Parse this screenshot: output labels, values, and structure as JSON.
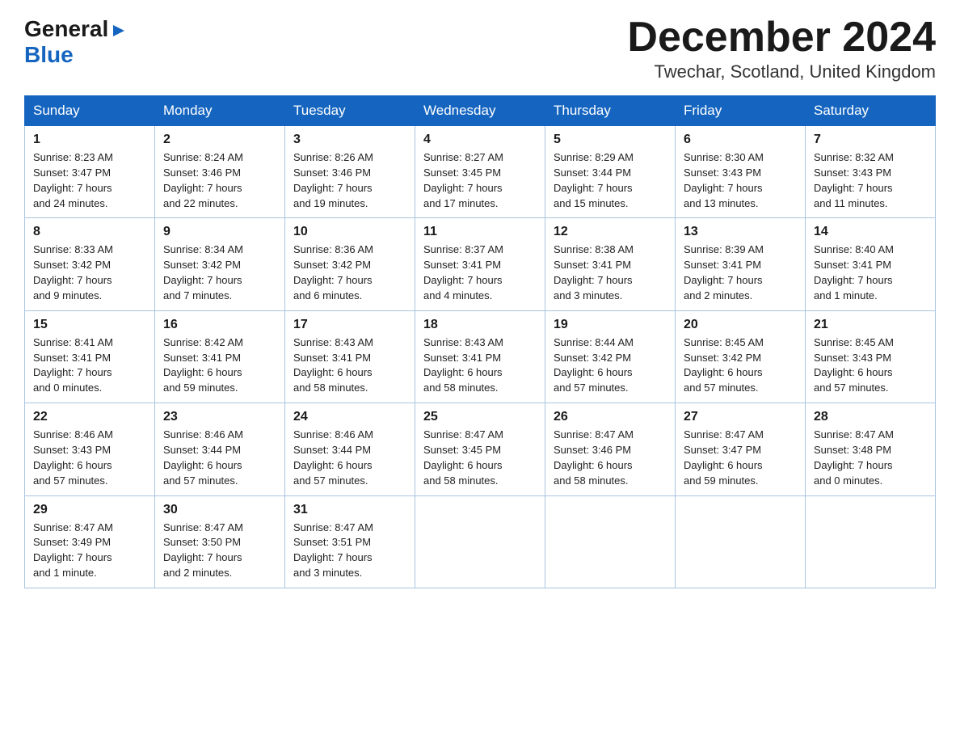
{
  "header": {
    "logo_general": "General",
    "logo_blue": "Blue",
    "month_title": "December 2024",
    "location": "Twechar, Scotland, United Kingdom"
  },
  "weekdays": [
    "Sunday",
    "Monday",
    "Tuesday",
    "Wednesday",
    "Thursday",
    "Friday",
    "Saturday"
  ],
  "weeks": [
    [
      {
        "day": "1",
        "sunrise": "Sunrise: 8:23 AM",
        "sunset": "Sunset: 3:47 PM",
        "daylight": "Daylight: 7 hours",
        "daylight2": "and 24 minutes."
      },
      {
        "day": "2",
        "sunrise": "Sunrise: 8:24 AM",
        "sunset": "Sunset: 3:46 PM",
        "daylight": "Daylight: 7 hours",
        "daylight2": "and 22 minutes."
      },
      {
        "day": "3",
        "sunrise": "Sunrise: 8:26 AM",
        "sunset": "Sunset: 3:46 PM",
        "daylight": "Daylight: 7 hours",
        "daylight2": "and 19 minutes."
      },
      {
        "day": "4",
        "sunrise": "Sunrise: 8:27 AM",
        "sunset": "Sunset: 3:45 PM",
        "daylight": "Daylight: 7 hours",
        "daylight2": "and 17 minutes."
      },
      {
        "day": "5",
        "sunrise": "Sunrise: 8:29 AM",
        "sunset": "Sunset: 3:44 PM",
        "daylight": "Daylight: 7 hours",
        "daylight2": "and 15 minutes."
      },
      {
        "day": "6",
        "sunrise": "Sunrise: 8:30 AM",
        "sunset": "Sunset: 3:43 PM",
        "daylight": "Daylight: 7 hours",
        "daylight2": "and 13 minutes."
      },
      {
        "day": "7",
        "sunrise": "Sunrise: 8:32 AM",
        "sunset": "Sunset: 3:43 PM",
        "daylight": "Daylight: 7 hours",
        "daylight2": "and 11 minutes."
      }
    ],
    [
      {
        "day": "8",
        "sunrise": "Sunrise: 8:33 AM",
        "sunset": "Sunset: 3:42 PM",
        "daylight": "Daylight: 7 hours",
        "daylight2": "and 9 minutes."
      },
      {
        "day": "9",
        "sunrise": "Sunrise: 8:34 AM",
        "sunset": "Sunset: 3:42 PM",
        "daylight": "Daylight: 7 hours",
        "daylight2": "and 7 minutes."
      },
      {
        "day": "10",
        "sunrise": "Sunrise: 8:36 AM",
        "sunset": "Sunset: 3:42 PM",
        "daylight": "Daylight: 7 hours",
        "daylight2": "and 6 minutes."
      },
      {
        "day": "11",
        "sunrise": "Sunrise: 8:37 AM",
        "sunset": "Sunset: 3:41 PM",
        "daylight": "Daylight: 7 hours",
        "daylight2": "and 4 minutes."
      },
      {
        "day": "12",
        "sunrise": "Sunrise: 8:38 AM",
        "sunset": "Sunset: 3:41 PM",
        "daylight": "Daylight: 7 hours",
        "daylight2": "and 3 minutes."
      },
      {
        "day": "13",
        "sunrise": "Sunrise: 8:39 AM",
        "sunset": "Sunset: 3:41 PM",
        "daylight": "Daylight: 7 hours",
        "daylight2": "and 2 minutes."
      },
      {
        "day": "14",
        "sunrise": "Sunrise: 8:40 AM",
        "sunset": "Sunset: 3:41 PM",
        "daylight": "Daylight: 7 hours",
        "daylight2": "and 1 minute."
      }
    ],
    [
      {
        "day": "15",
        "sunrise": "Sunrise: 8:41 AM",
        "sunset": "Sunset: 3:41 PM",
        "daylight": "Daylight: 7 hours",
        "daylight2": "and 0 minutes."
      },
      {
        "day": "16",
        "sunrise": "Sunrise: 8:42 AM",
        "sunset": "Sunset: 3:41 PM",
        "daylight": "Daylight: 6 hours",
        "daylight2": "and 59 minutes."
      },
      {
        "day": "17",
        "sunrise": "Sunrise: 8:43 AM",
        "sunset": "Sunset: 3:41 PM",
        "daylight": "Daylight: 6 hours",
        "daylight2": "and 58 minutes."
      },
      {
        "day": "18",
        "sunrise": "Sunrise: 8:43 AM",
        "sunset": "Sunset: 3:41 PM",
        "daylight": "Daylight: 6 hours",
        "daylight2": "and 58 minutes."
      },
      {
        "day": "19",
        "sunrise": "Sunrise: 8:44 AM",
        "sunset": "Sunset: 3:42 PM",
        "daylight": "Daylight: 6 hours",
        "daylight2": "and 57 minutes."
      },
      {
        "day": "20",
        "sunrise": "Sunrise: 8:45 AM",
        "sunset": "Sunset: 3:42 PM",
        "daylight": "Daylight: 6 hours",
        "daylight2": "and 57 minutes."
      },
      {
        "day": "21",
        "sunrise": "Sunrise: 8:45 AM",
        "sunset": "Sunset: 3:43 PM",
        "daylight": "Daylight: 6 hours",
        "daylight2": "and 57 minutes."
      }
    ],
    [
      {
        "day": "22",
        "sunrise": "Sunrise: 8:46 AM",
        "sunset": "Sunset: 3:43 PM",
        "daylight": "Daylight: 6 hours",
        "daylight2": "and 57 minutes."
      },
      {
        "day": "23",
        "sunrise": "Sunrise: 8:46 AM",
        "sunset": "Sunset: 3:44 PM",
        "daylight": "Daylight: 6 hours",
        "daylight2": "and 57 minutes."
      },
      {
        "day": "24",
        "sunrise": "Sunrise: 8:46 AM",
        "sunset": "Sunset: 3:44 PM",
        "daylight": "Daylight: 6 hours",
        "daylight2": "and 57 minutes."
      },
      {
        "day": "25",
        "sunrise": "Sunrise: 8:47 AM",
        "sunset": "Sunset: 3:45 PM",
        "daylight": "Daylight: 6 hours",
        "daylight2": "and 58 minutes."
      },
      {
        "day": "26",
        "sunrise": "Sunrise: 8:47 AM",
        "sunset": "Sunset: 3:46 PM",
        "daylight": "Daylight: 6 hours",
        "daylight2": "and 58 minutes."
      },
      {
        "day": "27",
        "sunrise": "Sunrise: 8:47 AM",
        "sunset": "Sunset: 3:47 PM",
        "daylight": "Daylight: 6 hours",
        "daylight2": "and 59 minutes."
      },
      {
        "day": "28",
        "sunrise": "Sunrise: 8:47 AM",
        "sunset": "Sunset: 3:48 PM",
        "daylight": "Daylight: 7 hours",
        "daylight2": "and 0 minutes."
      }
    ],
    [
      {
        "day": "29",
        "sunrise": "Sunrise: 8:47 AM",
        "sunset": "Sunset: 3:49 PM",
        "daylight": "Daylight: 7 hours",
        "daylight2": "and 1 minute."
      },
      {
        "day": "30",
        "sunrise": "Sunrise: 8:47 AM",
        "sunset": "Sunset: 3:50 PM",
        "daylight": "Daylight: 7 hours",
        "daylight2": "and 2 minutes."
      },
      {
        "day": "31",
        "sunrise": "Sunrise: 8:47 AM",
        "sunset": "Sunset: 3:51 PM",
        "daylight": "Daylight: 7 hours",
        "daylight2": "and 3 minutes."
      },
      null,
      null,
      null,
      null
    ]
  ]
}
